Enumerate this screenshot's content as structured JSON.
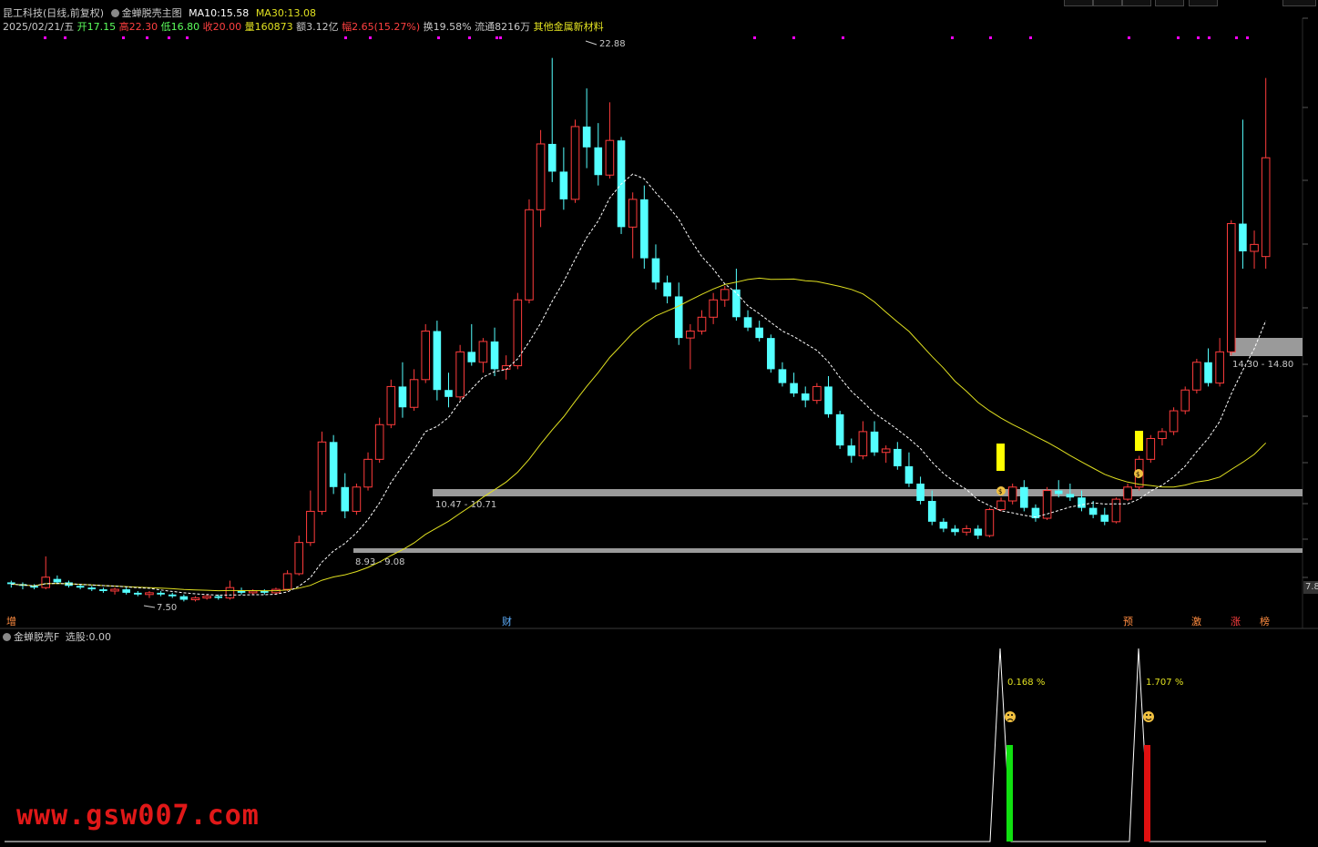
{
  "header": {
    "stock_name": "昆工科技",
    "period": "(日线,前复权)",
    "formula_name": "金蝉脱壳主图",
    "ma10_label": "MA10:",
    "ma10_value": "15.58",
    "ma30_label": "MA30:",
    "ma30_value": "13.08"
  },
  "quote": {
    "date": "2025/02/21/五",
    "open_label": "开",
    "open": "17.15",
    "high_label": "高",
    "high": "22.30",
    "low_label": "低",
    "low": "16.80",
    "close_label": "收",
    "close": "20.00",
    "vol_label": "量",
    "vol": "160873",
    "amount_label": "额",
    "amount": "3.12亿",
    "change_label": "幅",
    "change": "2.65(15.27%)",
    "turnover_label": "换",
    "turnover": "19.58%",
    "float_label": "流通",
    "float": "8216万",
    "sector": "其他金属新材料"
  },
  "annotations": {
    "peak": "22.88",
    "low": "7.50",
    "support1": "10.47 - 10.71",
    "support2": "8.93 - 9.08",
    "resist": "14.30 - 14.80",
    "axis_right": "7.8"
  },
  "markers": {
    "left": "增",
    "mid": "财",
    "r1": "预",
    "r2": "激",
    "r3": "涨",
    "r4": "榜"
  },
  "sub": {
    "title": "金蝉脱壳F",
    "select_label": "选股:",
    "select_value": "0.00",
    "pct1": "0.168",
    "pct2": "1.707",
    "pct_sign": "%"
  },
  "watermark": "www.gsw007.com",
  "colors": {
    "up": "#ff3c3c",
    "down": "#54ffff",
    "ma10": "#ffffff",
    "ma30": "#e0e020",
    "band": "#9a9a9a",
    "signal": "#ffff00",
    "magenta": "#ff00ff",
    "watermark": "#e01818"
  },
  "chart_data": {
    "type": "candlestick",
    "title": "金蝉脱壳主图",
    "series": [
      {
        "name": "K线",
        "ohlc_note": "daily candles, approx values",
        "values": [
          [
            7.75,
            7.8,
            7.6,
            7.7
          ],
          [
            7.7,
            7.75,
            7.55,
            7.65
          ],
          [
            7.65,
            7.7,
            7.55,
            7.6
          ],
          [
            7.6,
            8.5,
            7.55,
            7.9
          ],
          [
            7.85,
            7.95,
            7.7,
            7.75
          ],
          [
            7.75,
            7.8,
            7.6,
            7.65
          ],
          [
            7.65,
            7.7,
            7.55,
            7.6
          ],
          [
            7.6,
            7.65,
            7.5,
            7.55
          ],
          [
            7.55,
            7.6,
            7.45,
            7.5
          ],
          [
            7.5,
            7.6,
            7.4,
            7.55
          ],
          [
            7.55,
            7.6,
            7.4,
            7.45
          ],
          [
            7.45,
            7.5,
            7.35,
            7.4
          ],
          [
            7.4,
            7.5,
            7.3,
            7.45
          ],
          [
            7.45,
            7.5,
            7.35,
            7.4
          ],
          [
            7.4,
            7.45,
            7.3,
            7.35
          ],
          [
            7.35,
            7.4,
            7.2,
            7.25
          ],
          [
            7.25,
            7.35,
            7.2,
            7.3
          ],
          [
            7.3,
            7.4,
            7.25,
            7.35
          ],
          [
            7.35,
            7.4,
            7.25,
            7.3
          ],
          [
            7.3,
            7.8,
            7.25,
            7.6
          ],
          [
            7.5,
            7.6,
            7.4,
            7.45
          ],
          [
            7.45,
            7.55,
            7.4,
            7.5
          ],
          [
            7.5,
            7.55,
            7.4,
            7.45
          ],
          [
            7.45,
            7.6,
            7.4,
            7.55
          ],
          [
            7.55,
            8.1,
            7.5,
            8.0
          ],
          [
            8.0,
            9.1,
            7.95,
            8.9
          ],
          [
            8.9,
            10.4,
            8.8,
            9.8
          ],
          [
            9.8,
            12.1,
            9.7,
            11.8
          ],
          [
            11.8,
            12.0,
            10.3,
            10.5
          ],
          [
            10.5,
            10.9,
            9.6,
            9.8
          ],
          [
            9.8,
            10.6,
            9.7,
            10.5
          ],
          [
            10.5,
            11.5,
            10.4,
            11.3
          ],
          [
            11.3,
            12.5,
            11.2,
            12.3
          ],
          [
            12.3,
            13.6,
            12.2,
            13.4
          ],
          [
            13.4,
            14.1,
            12.5,
            12.8
          ],
          [
            12.8,
            13.9,
            12.7,
            13.6
          ],
          [
            13.6,
            15.2,
            13.5,
            15.0
          ],
          [
            15.0,
            15.3,
            13.0,
            13.3
          ],
          [
            13.3,
            13.8,
            12.8,
            13.1
          ],
          [
            13.1,
            14.6,
            13.0,
            14.4
          ],
          [
            14.4,
            15.2,
            14.0,
            14.1
          ],
          [
            14.1,
            14.8,
            13.8,
            14.7
          ],
          [
            14.7,
            15.1,
            13.7,
            13.9
          ],
          [
            13.9,
            14.3,
            13.6,
            14.0
          ],
          [
            14.0,
            16.1,
            13.9,
            15.9
          ],
          [
            15.9,
            18.8,
            15.8,
            18.5
          ],
          [
            18.5,
            20.8,
            18.0,
            20.4
          ],
          [
            20.4,
            22.88,
            19.3,
            19.6
          ],
          [
            19.6,
            20.3,
            18.5,
            18.8
          ],
          [
            18.8,
            21.1,
            18.7,
            20.9
          ],
          [
            20.9,
            22.0,
            19.7,
            20.3
          ],
          [
            20.3,
            21.0,
            19.2,
            19.5
          ],
          [
            19.5,
            21.6,
            19.4,
            20.5
          ],
          [
            20.5,
            20.6,
            17.8,
            18.0
          ],
          [
            18.0,
            19.0,
            17.1,
            18.8
          ],
          [
            18.8,
            19.2,
            16.8,
            17.1
          ],
          [
            17.1,
            17.5,
            16.2,
            16.4
          ],
          [
            16.4,
            16.6,
            15.8,
            16.0
          ],
          [
            16.0,
            16.4,
            14.6,
            14.8
          ],
          [
            14.8,
            15.2,
            13.9,
            15.0
          ],
          [
            15.0,
            15.6,
            14.9,
            15.4
          ],
          [
            15.4,
            16.1,
            15.2,
            15.9
          ],
          [
            15.9,
            16.3,
            15.7,
            16.2
          ],
          [
            16.2,
            16.8,
            15.3,
            15.4
          ],
          [
            15.4,
            15.6,
            15.0,
            15.1
          ],
          [
            15.1,
            15.3,
            14.7,
            14.8
          ],
          [
            14.8,
            14.9,
            13.8,
            13.9
          ],
          [
            13.9,
            14.1,
            13.4,
            13.5
          ],
          [
            13.5,
            13.8,
            13.1,
            13.2
          ],
          [
            13.2,
            13.4,
            12.8,
            13.0
          ],
          [
            13.0,
            13.5,
            12.9,
            13.4
          ],
          [
            13.4,
            13.7,
            12.5,
            12.6
          ],
          [
            12.6,
            12.7,
            11.6,
            11.7
          ],
          [
            11.7,
            11.9,
            11.2,
            11.4
          ],
          [
            11.4,
            12.4,
            11.3,
            12.1
          ],
          [
            12.1,
            12.4,
            11.4,
            11.5
          ],
          [
            11.5,
            11.7,
            11.2,
            11.6
          ],
          [
            11.6,
            11.8,
            11.0,
            11.1
          ],
          [
            11.1,
            11.5,
            10.5,
            10.6
          ],
          [
            10.6,
            10.8,
            10.0,
            10.1
          ],
          [
            10.1,
            10.4,
            9.4,
            9.5
          ],
          [
            9.5,
            9.6,
            9.2,
            9.3
          ],
          [
            9.3,
            9.4,
            9.1,
            9.2
          ],
          [
            9.2,
            9.4,
            9.1,
            9.3
          ],
          [
            9.3,
            9.4,
            9.0,
            9.1
          ],
          [
            9.1,
            9.9,
            9.05,
            9.85
          ],
          [
            9.85,
            10.2,
            9.8,
            10.1
          ],
          [
            10.1,
            10.6,
            10.0,
            10.5
          ],
          [
            10.5,
            10.7,
            9.8,
            9.9
          ],
          [
            9.9,
            10.0,
            9.5,
            9.6
          ],
          [
            9.6,
            10.5,
            9.55,
            10.4
          ],
          [
            10.4,
            10.7,
            10.2,
            10.3
          ],
          [
            10.3,
            10.6,
            10.1,
            10.2
          ],
          [
            10.2,
            10.4,
            9.8,
            9.9
          ],
          [
            9.9,
            10.1,
            9.6,
            9.7
          ],
          [
            9.7,
            9.9,
            9.4,
            9.5
          ],
          [
            9.5,
            10.2,
            9.45,
            10.15
          ],
          [
            10.15,
            10.6,
            10.1,
            10.5
          ],
          [
            10.5,
            11.4,
            10.4,
            11.3
          ],
          [
            11.3,
            12.0,
            11.2,
            11.9
          ],
          [
            11.9,
            12.2,
            11.7,
            12.1
          ],
          [
            12.1,
            12.8,
            12.0,
            12.7
          ],
          [
            12.7,
            13.4,
            12.6,
            13.3
          ],
          [
            13.3,
            14.2,
            13.2,
            14.1
          ],
          [
            14.1,
            14.5,
            13.4,
            13.5
          ],
          [
            13.5,
            14.8,
            13.4,
            14.4
          ],
          [
            14.4,
            18.2,
            14.3,
            18.1
          ],
          [
            18.1,
            21.1,
            16.8,
            17.3
          ],
          [
            17.3,
            17.9,
            16.8,
            17.5
          ],
          [
            17.15,
            22.3,
            16.8,
            20.0
          ]
        ]
      },
      {
        "name": "MA10"
      },
      {
        "name": "MA30"
      }
    ],
    "ylim": [
      7.0,
      23.5
    ]
  }
}
